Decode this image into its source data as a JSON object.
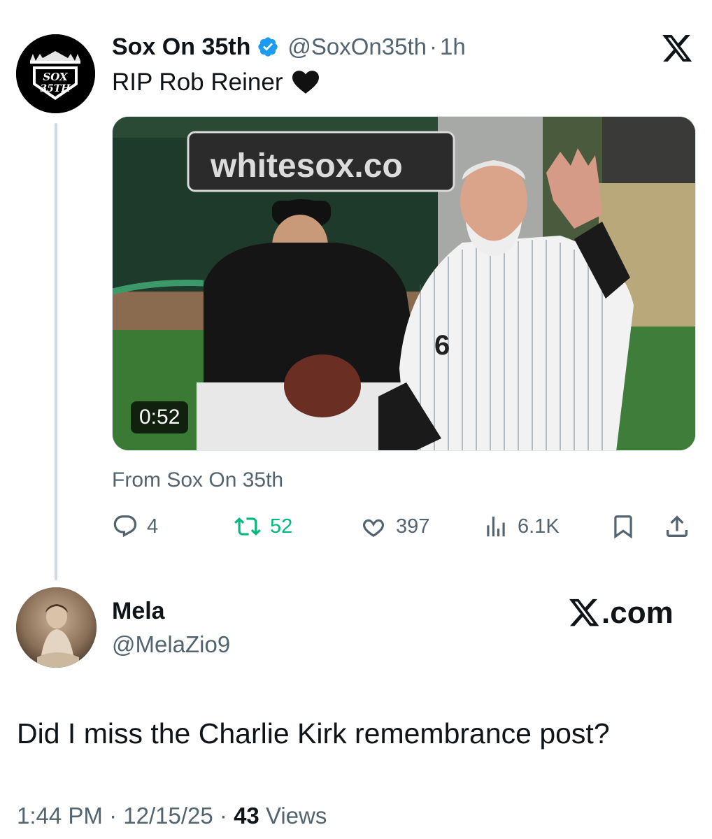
{
  "parent_tweet": {
    "display_name": "Sox On 35th",
    "handle": "@SoxOn35th",
    "separator": "·",
    "time": "1h",
    "text": "RIP Rob Reiner",
    "emoji": "black-heart",
    "avatar_logo_text": "SOX 35TH",
    "media": {
      "duration": "0:52",
      "banner_text": "whitesox.co"
    },
    "from_line": "From Sox On 35th",
    "stats": {
      "replies": "4",
      "reposts": "52",
      "likes": "397",
      "views": "6.1K"
    },
    "colors": {
      "repost_active": "#00ba7c",
      "verified_blue": "#1d9bf0",
      "secondary_text": "#536471"
    }
  },
  "reply": {
    "display_name": "Mela",
    "handle": "@MelaZio9",
    "text": "Did I miss the Charlie Kirk remembrance post?",
    "time": "1:44 PM",
    "date": "12/15/25",
    "sep1": "·",
    "sep2": "·",
    "views_count": "43",
    "views_label": "Views"
  },
  "watermark": {
    "suffix": ".com"
  },
  "icons": {
    "top_right": "x-logo-icon",
    "verified": "verified-badge-icon",
    "reply": "reply-icon",
    "repost": "repost-icon",
    "like": "heart-icon",
    "views": "views-icon",
    "bookmark": "bookmark-icon",
    "share": "share-icon"
  }
}
